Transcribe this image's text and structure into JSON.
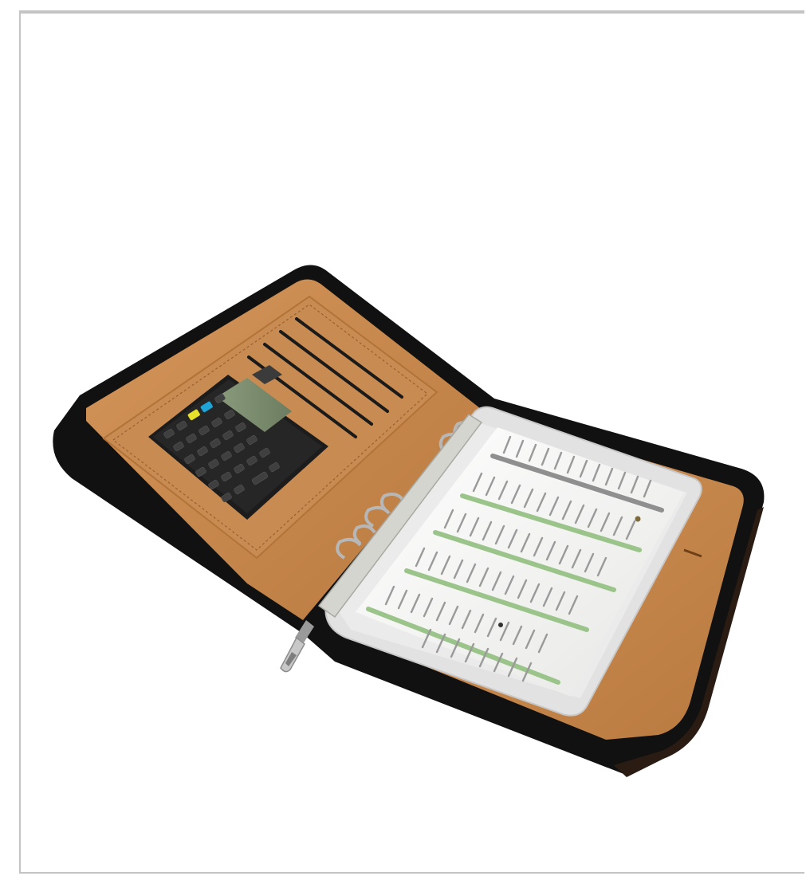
{
  "image": {
    "subject": "zippered-binder-with-calculator-and-dental-burs",
    "alt": ""
  },
  "colors": {
    "background": "#ffffff",
    "frame_border": "#c4c4c4",
    "binder_leather": "#111111",
    "binder_lining": "#c98a4e",
    "lining_dark": "#b9773d",
    "calculator_body": "#1c1c1c",
    "calculator_display": "#7d8f6f",
    "key_yellow": "#e8e12a",
    "key_blue": "#1fa4d8",
    "page_white": "#f4f4f2",
    "sleeve_clear": "#dcdcdc",
    "label_green": "#9bc48a",
    "ring_metal": "#b7b7b7"
  }
}
